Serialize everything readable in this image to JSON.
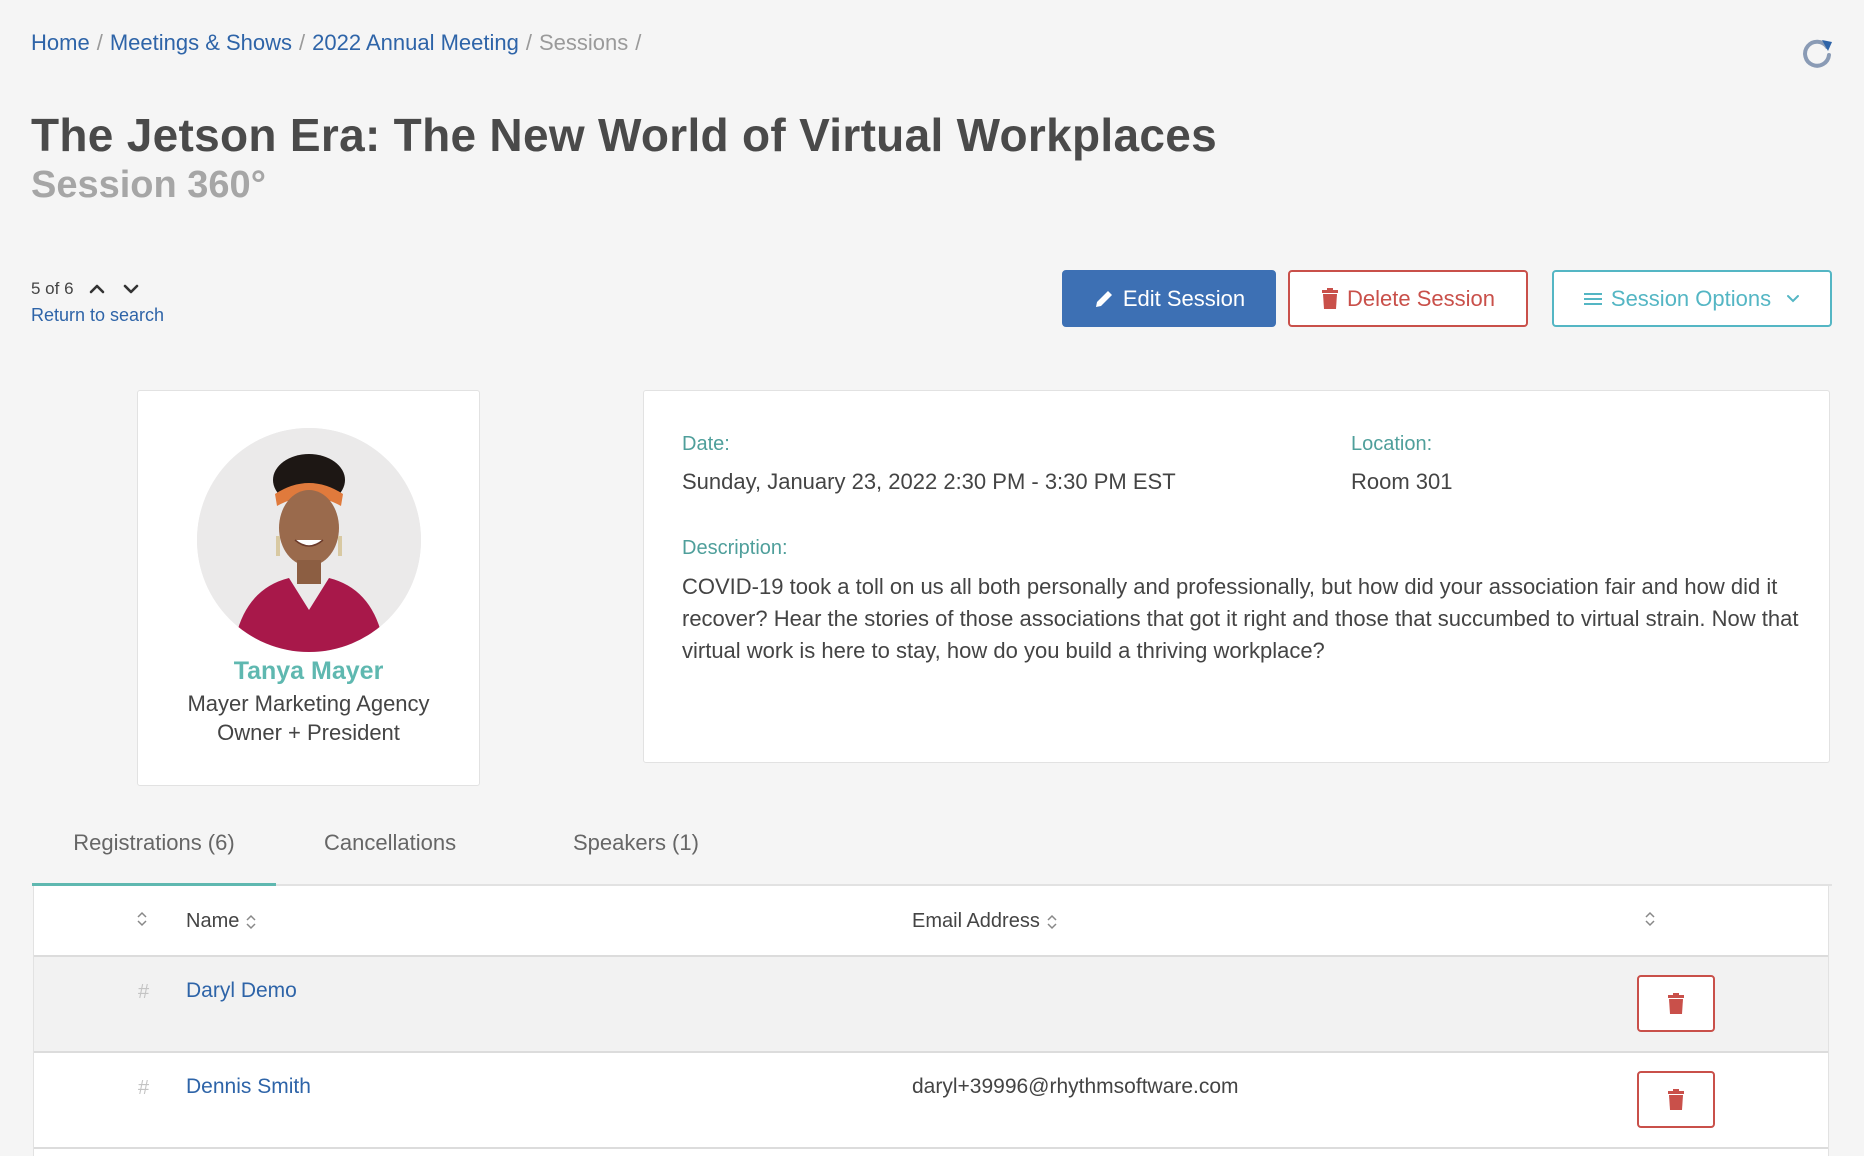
{
  "breadcrumb": [
    {
      "label": "Home"
    },
    {
      "label": "Meetings & Shows"
    },
    {
      "label": "2022 Annual Meeting"
    },
    {
      "label": "Sessions"
    }
  ],
  "breadcrumb_separator": "/",
  "page": {
    "title": "The Jetson Era: The New World of Virtual Workplaces",
    "subtitle": "Session 360°"
  },
  "pager": {
    "position": "5 of 6",
    "return_label": "Return to search"
  },
  "actions": {
    "edit_label": "Edit Session",
    "delete_label": "Delete Session",
    "options_label": "Session Options"
  },
  "speaker": {
    "name": "Tanya Mayer",
    "organization": "Mayer Marketing Agency",
    "role": "Owner + President"
  },
  "details": {
    "date_label": "Date:",
    "date_value": "Sunday, January 23, 2022 2:30 PM - 3:30 PM EST",
    "location_label": "Location:",
    "location_value": "Room 301",
    "description_label": "Description:",
    "description_value": "COVID-19 took a toll on us all both personally and professionally, but how did your association fair and how did it recover? Hear the stories of those associations that got it right and those that succumbed to virtual strain. Now that virtual work is here to stay, how do you build a thriving workplace?"
  },
  "tabs": [
    {
      "label": "Registrations (6)",
      "active": true
    },
    {
      "label": "Cancellations",
      "active": false
    },
    {
      "label": "Speakers (1)",
      "active": false
    }
  ],
  "table": {
    "columns": {
      "name": "Name",
      "email": "Email Address"
    },
    "rows": [
      {
        "marker": "#",
        "name": "Daryl Demo",
        "email": ""
      },
      {
        "marker": "#",
        "name": "Dennis Smith",
        "email": "daryl+39996@rhythmsoftware.com"
      }
    ]
  },
  "colors": {
    "link": "#2e64a8",
    "primary": "#3d70b4",
    "danger": "#c9504a",
    "info": "#54b6c4",
    "accent_teal": "#5fb8b0"
  }
}
